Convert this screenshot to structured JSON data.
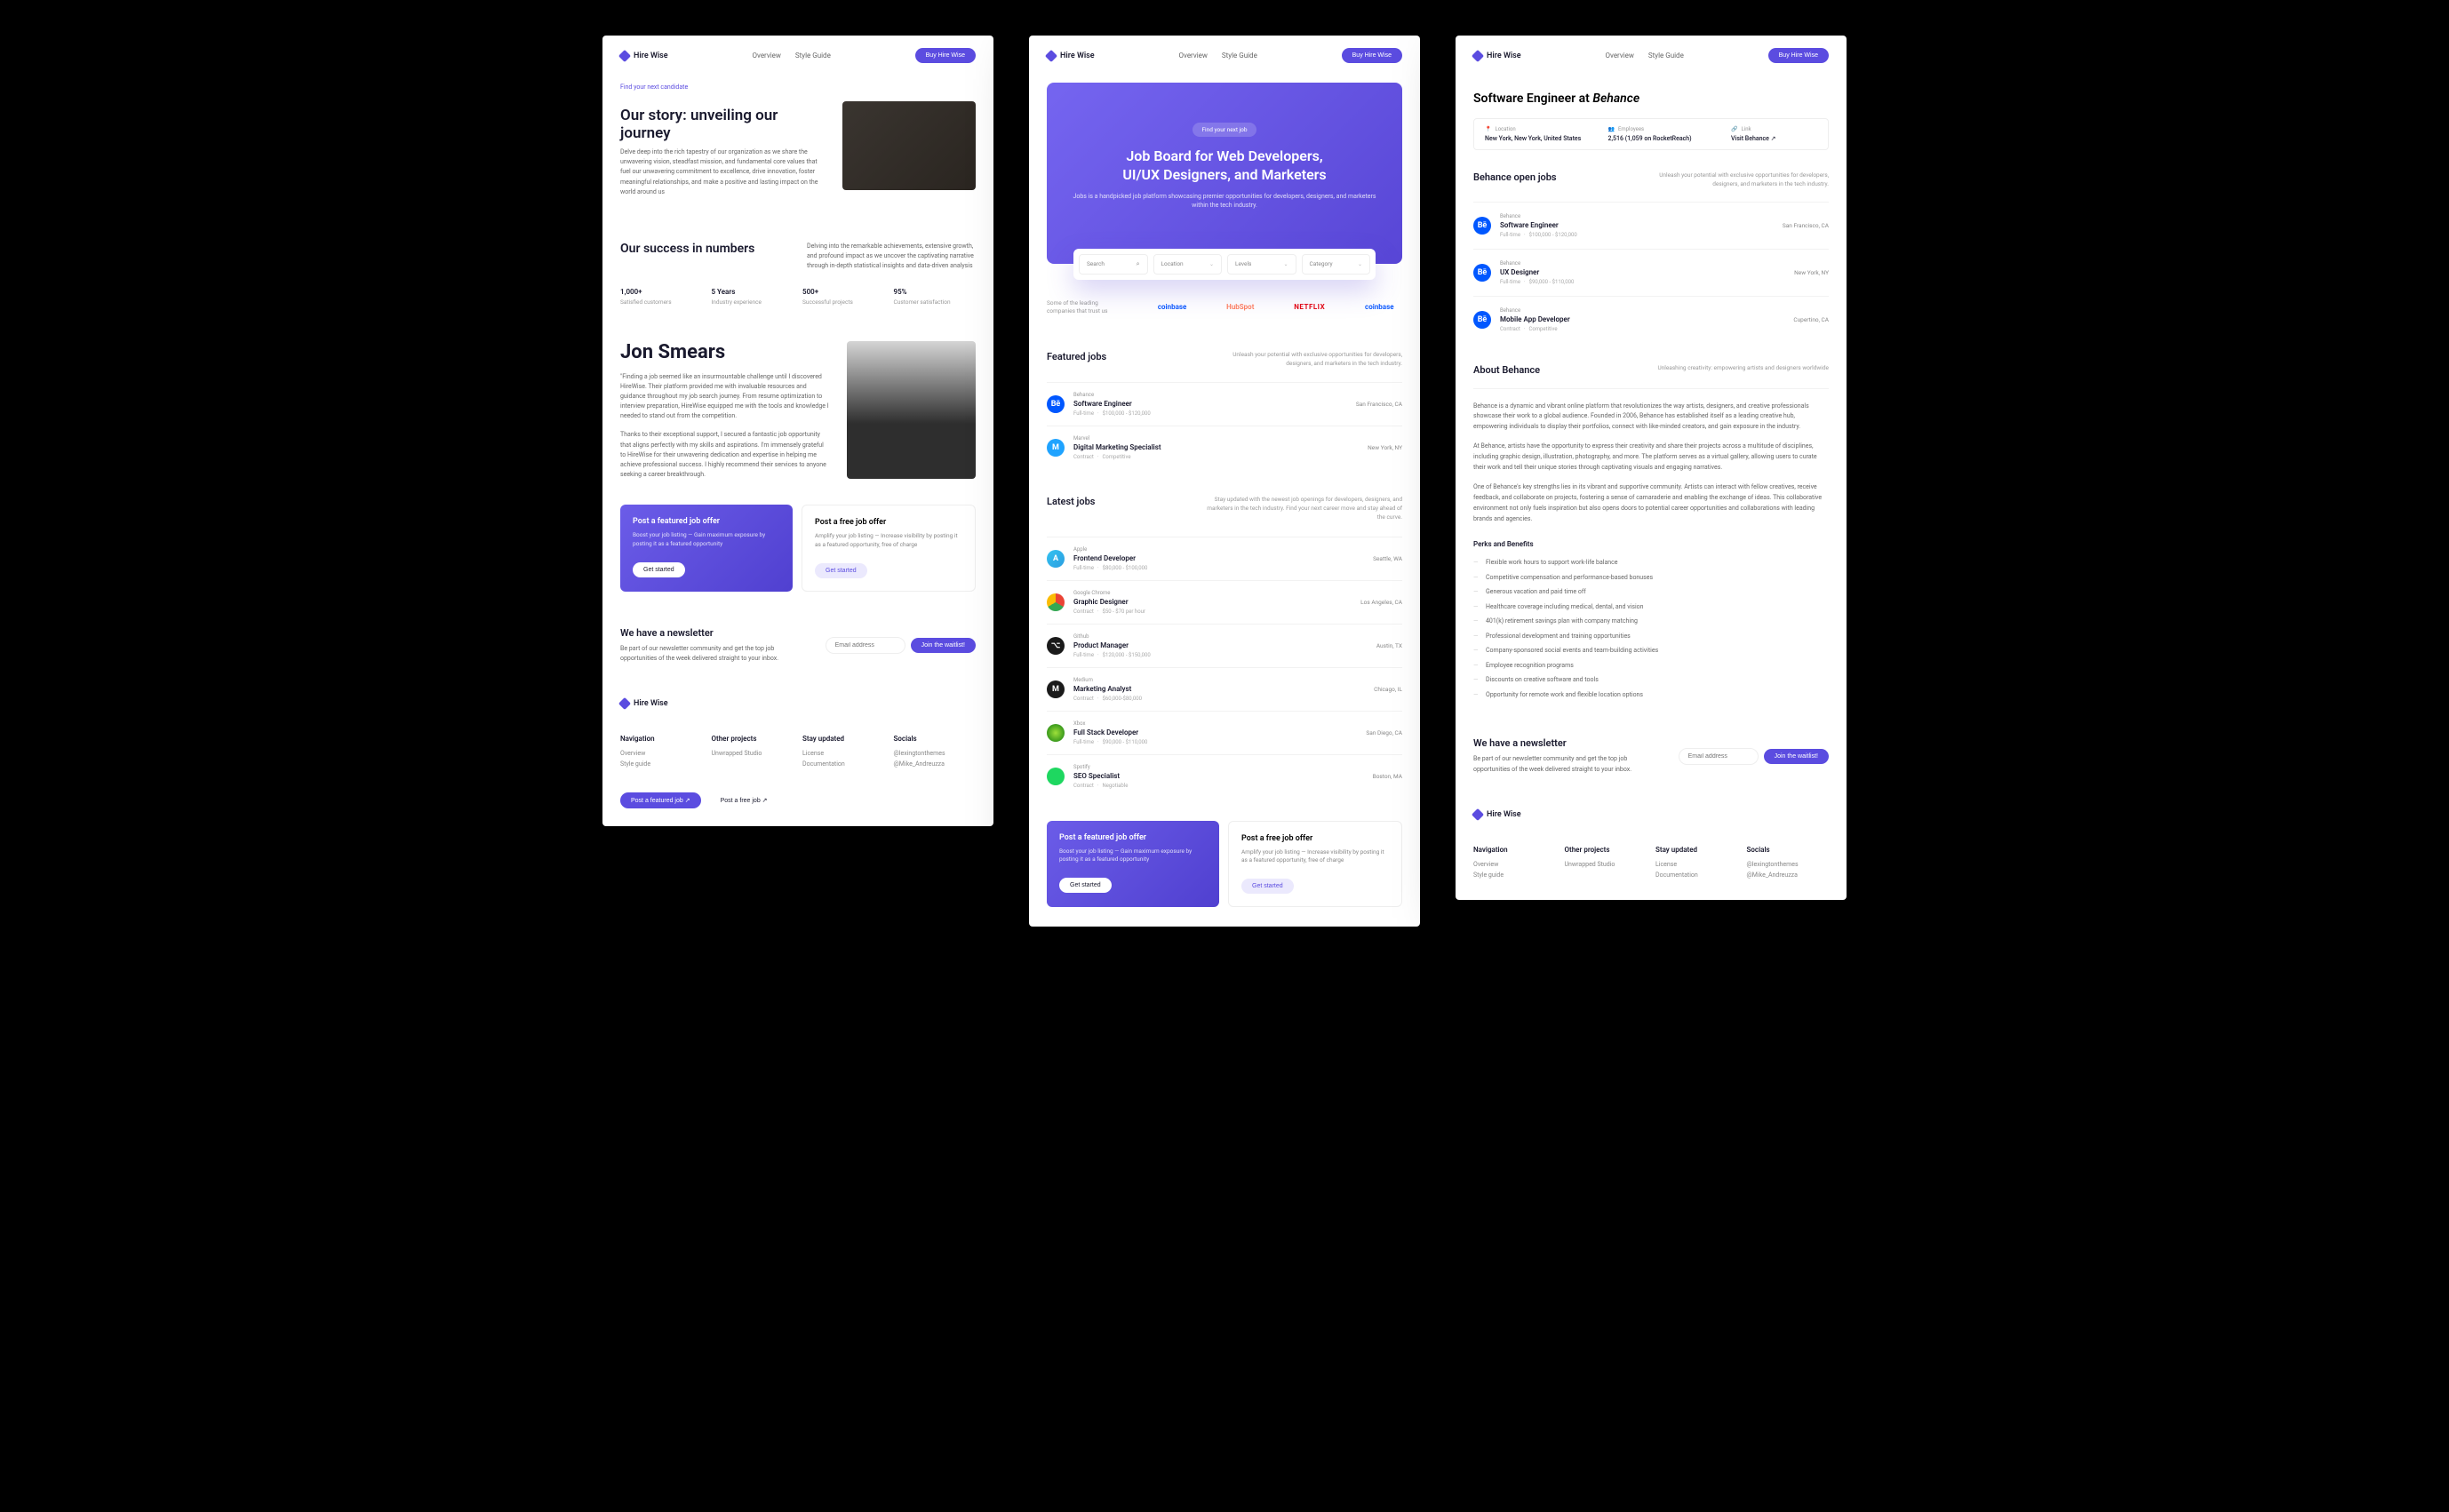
{
  "brand": "Hire Wise",
  "nav": {
    "overview": "Overview",
    "style": "Style Guide",
    "cta": "Buy Hire Wise"
  },
  "page1": {
    "tag": "Find your next candidate",
    "storyTitle": "Our story: unveiling our journey",
    "storyBody": "Delve deep into the rich tapestry of our organization as we share the unwavering vision, steadfast mission, and fundamental core values that fuel our unwavering commitment to excellence, drive innovation, foster meaningful relationships, and make a positive and lasting impact on the world around us",
    "numbersTitle": "Our success in numbers",
    "numbersBody": "Delving into the remarkable achievements, extensive growth, and profound impact as we uncover the captivating narrative through in-depth statistical insights and data-driven analysis",
    "stats": [
      {
        "num": "1,000+",
        "label": "Satisfied customers"
      },
      {
        "num": "5 Years",
        "label": "Industry experience"
      },
      {
        "num": "500+",
        "label": "Successful projects"
      },
      {
        "num": "95%",
        "label": "Customer satisfaction"
      }
    ],
    "person": {
      "name": "Jon Smears",
      "quote1": "\"Finding a job seemed like an insurmountable challenge until I discovered HireWise. Their platform provided me with invaluable resources and guidance throughout my job search journey. From resume optimization to interview preparation, HireWise equipped me with the tools and knowledge I needed to stand out from the competition.",
      "quote2": "Thanks to their exceptional support, I secured a fantastic job opportunity that aligns perfectly with my skills and aspirations. I'm immensely grateful to HireWise for their unwavering dedication and expertise in helping me achieve professional success. I highly recommend their services to anyone seeking a career breakthrough."
    }
  },
  "cta": {
    "featured": {
      "title": "Post a featured job offer",
      "desc": "Boost your job listing — Gain maximum exposure by posting it as a featured opportunity",
      "btn": "Get started"
    },
    "free": {
      "title": "Post a free job offer",
      "desc": "Amplify your job listing — Increase visibility by posting it as a featured opportunity, free of charge",
      "btn": "Get started"
    }
  },
  "newsletter": {
    "title": "We have a newsletter",
    "body": "Be part of our newsletter community and get the top job opportunities of the week delivered straight to your inbox.",
    "placeholder": "Email address",
    "btn": "Join the waitlist!"
  },
  "footer": {
    "cols": [
      {
        "title": "Navigation",
        "links": [
          "Overview",
          "Style guide"
        ]
      },
      {
        "title": "Other projects",
        "links": [
          "Unwrapped Studio"
        ]
      },
      {
        "title": "Stay updated",
        "links": [
          "License",
          "Documentation"
        ]
      },
      {
        "title": "Socials",
        "links": [
          "@lexingtonthemes",
          "@Mike_Andreuzza"
        ]
      }
    ],
    "btnFeatured": "Post a featured job ↗",
    "btnFree": "Post a free job ↗"
  },
  "page2": {
    "heroTag": "Find your next job",
    "heroTitle1": "Job Board for Web Developers,",
    "heroTitle2": "UI/UX Designers, and Marketers",
    "heroSub": "Jobs is a handpicked job platform showcasing premier opportunities for developers, designers, and marketers within the tech industry.",
    "search": {
      "searchLabel": "Search",
      "locationLabel": "Location",
      "levelsLabel": "Levels",
      "categoryLabel": "Category"
    },
    "brandsText": "Some of the leading companies that trust us",
    "brands": [
      "coinbase",
      "HubSpot",
      "NETFLIX",
      "coinbase"
    ],
    "featured": {
      "title": "Featured jobs",
      "sub": "Unleash your potential with exclusive opportunities for developers, designers, and marketers in the tech industry.",
      "jobs": [
        {
          "company": "Behance",
          "title": "Software Engineer",
          "type": "Full-time",
          "salary": "$100,000 - $120,000",
          "location": "San Francisco, CA",
          "bg": "#0057ff",
          "ic": "Bē"
        },
        {
          "company": "Marvel",
          "title": "Digital Marketing Specialist",
          "type": "Contract",
          "salary": "Competitive",
          "location": "New York, NY",
          "bg": "#1fa3ff",
          "ic": "M"
        }
      ]
    },
    "latest": {
      "title": "Latest jobs",
      "sub": "Stay updated with the newest job openings for developers, designers, and marketers in the tech industry. Find your next career move and stay ahead of the curve.",
      "jobs": [
        {
          "company": "Apple",
          "title": "Frontend Developer",
          "type": "Full-time",
          "salary": "$80,000 - $100,000",
          "location": "Seattle, WA",
          "bg": "linear-gradient(135deg,#34c3f1,#2b9de0)",
          "ic": "A"
        },
        {
          "company": "Google Chrome",
          "title": "Graphic Designer",
          "type": "Contract",
          "salary": "$50 - $70 per hour",
          "location": "Los Angeles, CA",
          "bg": "conic-gradient(#ea4335 0 120deg,#34a853 120deg 240deg,#fbbc05 240deg 360deg)",
          "ic": ""
        },
        {
          "company": "Github",
          "title": "Product Manager",
          "type": "Full-time",
          "salary": "$120,000 - $150,000",
          "location": "Austin, TX",
          "bg": "#1a1a1a",
          "ic": "⌥"
        },
        {
          "company": "Medium",
          "title": "Marketing Analyst",
          "type": "Contract",
          "salary": "$60,000-$80,000",
          "location": "Chicago, IL",
          "bg": "#1a1a1a",
          "ic": "M"
        },
        {
          "company": "Xbox",
          "title": "Full Stack Developer",
          "type": "Full-time",
          "salary": "$90,000 - $110,000",
          "location": "San Diego, CA",
          "bg": "radial-gradient(circle,#9ee03a,#107c10)",
          "ic": ""
        },
        {
          "company": "Spotify",
          "title": "SEO Specialist",
          "type": "Contract",
          "salary": "Negotiable",
          "location": "Boston, MA",
          "bg": "#1ed760",
          "ic": ""
        }
      ]
    }
  },
  "page3": {
    "title": "Software Engineer at",
    "company": "Behance",
    "info": {
      "locationLabel": "Location",
      "location": "New York, New York, United States",
      "employeesLabel": "Employees",
      "employees": "2,516 (1,059 on RocketReach)",
      "linkLabel": "Link",
      "link": "Visit Behance ↗"
    },
    "openJobs": {
      "title": "Behance open jobs",
      "sub": "Unleash your potential with exclusive opportunities for developers, designers, and marketers in the tech industry.",
      "jobs": [
        {
          "title": "Software Engineer",
          "type": "Full-time",
          "salary": "$100,000 - $120,000",
          "location": "San Francisco, CA"
        },
        {
          "title": "UX Designer",
          "type": "Full-time",
          "salary": "$90,000 - $110,000",
          "location": "New York, NY"
        },
        {
          "title": "Mobile App Developer",
          "type": "Contract",
          "salary": "Competitive",
          "location": "Cupertino, CA"
        }
      ]
    },
    "about": {
      "title": "About Behance",
      "sub": "Unleashing creativity: empowering artists and designers worldwide",
      "p1": "Behance is a dynamic and vibrant online platform that revolutionizes the way artists, designers, and creative professionals showcase their work to a global audience. Founded in 2006, Behance has established itself as a leading creative hub, empowering individuals to display their portfolios, connect with like-minded creators, and gain exposure in the industry.",
      "p2": "At Behance, artists have the opportunity to express their creativity and share their projects across a multitude of disciplines, including graphic design, illustration, photography, and more. The platform serves as a virtual gallery, allowing users to curate their work and tell their unique stories through captivating visuals and engaging narratives.",
      "p3": "One of Behance's key strengths lies in its vibrant and supportive community. Artists can interact with fellow creatives, receive feedback, and collaborate on projects, fostering a sense of camaraderie and enabling the exchange of ideas. This collaborative environment not only fuels inspiration but also opens doors to potential career opportunities and collaborations with leading brands and agencies.",
      "perksTitle": "Perks and Benefits",
      "perks": [
        "Flexible work hours to support work-life balance",
        "Competitive compensation and performance-based bonuses",
        "Generous vacation and paid time off",
        "Healthcare coverage including medical, dental, and vision",
        "401(k) retirement savings plan with company matching",
        "Professional development and training opportunities",
        "Company-sponsored social events and team-building activities",
        "Employee recognition programs",
        "Discounts on creative software and tools",
        "Opportunity for remote work and flexible location options"
      ]
    }
  }
}
